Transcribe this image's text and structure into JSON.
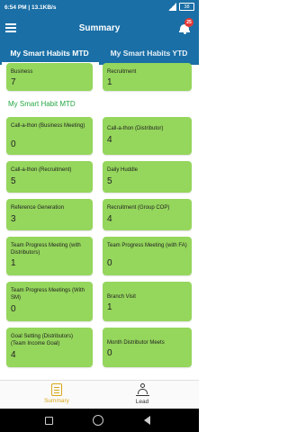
{
  "status": {
    "time": "6:54 PM",
    "speed": "13.1KB/s",
    "battery": "38"
  },
  "appbar": {
    "title": "Summary",
    "notification_count": "25"
  },
  "tabs": [
    {
      "label": "My Smart Habits MTD"
    },
    {
      "label": "My Smart Habits YTD"
    }
  ],
  "top_cards": [
    {
      "label": "Business",
      "value": "7"
    },
    {
      "label": "Recruitment",
      "value": "1"
    }
  ],
  "section_title": "My Smart Habit MTD",
  "cards": [
    {
      "label": "Call-a-thon (Business Meeting)",
      "value": "0"
    },
    {
      "label": "Call-a-thon (Distributor)",
      "value": "4"
    },
    {
      "label": "Call-a-thon (Recruitment)",
      "value": "5"
    },
    {
      "label": "Daily Huddle",
      "value": "5"
    },
    {
      "label": "Reference Generation",
      "value": "3"
    },
    {
      "label": "Recruitment (Group COP)",
      "value": "4"
    },
    {
      "label": "Team Progress Meeting (with Distributors)",
      "value": "1"
    },
    {
      "label": "Team Progress Meeting (with FA)",
      "value": "0"
    },
    {
      "label": "Team Progress Meetings (With SM)",
      "value": "0"
    },
    {
      "label": "Branch Visit",
      "value": "1"
    },
    {
      "label": "Goal Setting (Distributors) (Team Income Goal)",
      "value": "4"
    },
    {
      "label": "Month Distributor Meets",
      "value": "0"
    }
  ],
  "bottom_nav": [
    {
      "label": "Summary",
      "icon": "clipboard-icon",
      "active": true
    },
    {
      "label": "Lead",
      "icon": "person-icon",
      "active": false
    }
  ],
  "colors": {
    "primary": "#1a6fa6",
    "card": "#95d65c",
    "section": "#27a844",
    "active_nav": "#d8a818"
  }
}
